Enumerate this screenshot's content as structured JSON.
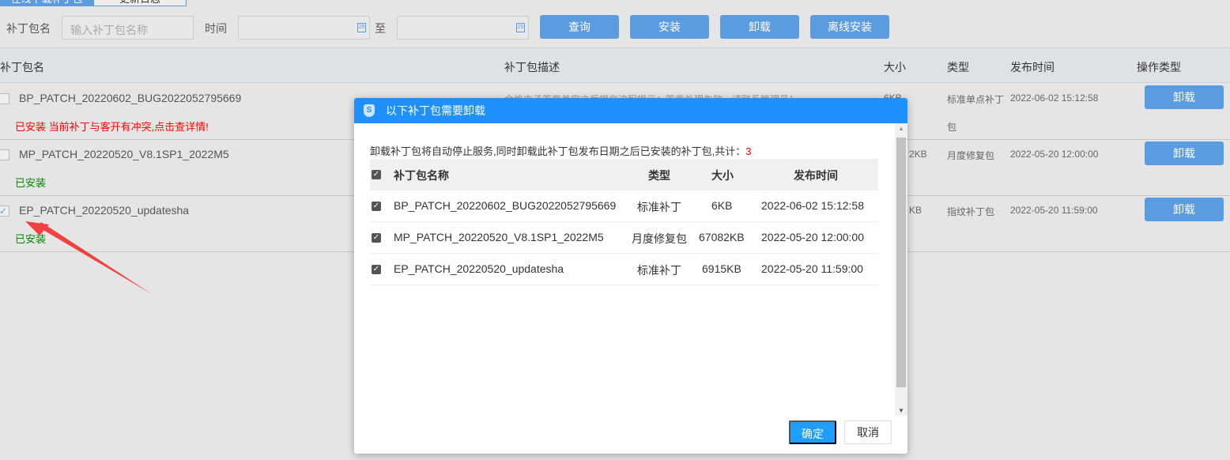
{
  "tabs": [
    "在线下载补丁包",
    "更新日志"
  ],
  "filter": {
    "name_label": "补丁包名",
    "name_placeholder": "输入补丁包名称",
    "time_label": "时间",
    "to_label": "至",
    "query": "查询",
    "install": "安装",
    "uninstall": "卸载",
    "offline_install": "离线安装"
  },
  "table": {
    "headers": [
      "补丁包名",
      "补丁包描述",
      "大小",
      "类型",
      "发布时间",
      "操作类型"
    ],
    "rows": [
      {
        "name": "BP_PATCH_20220602_BUG2022052795669",
        "status": "已安装 当前补丁与客开有冲突,点击查详情!",
        "desc": "金格电子签章盖完之后提交流程提示：签章处理失败，请联系管理员！",
        "size": "6KB",
        "type": "标准单点补丁",
        "type2": "包",
        "date": "2022-06-02 15:12:58",
        "action": "卸载",
        "checked": ""
      },
      {
        "name": "MP_PATCH_20220520_V8.1SP1_2022M5",
        "status": "已安装",
        "size": "2KB",
        "type": "月度修复包",
        "date": "2022-05-20 12:00:00",
        "action": "卸载",
        "checked": ""
      },
      {
        "name": "EP_PATCH_20220520_updatesha",
        "status": "已安装",
        "size": "KB",
        "type": "指纹补丁包",
        "date": "2022-05-20 11:59:00",
        "action": "卸载",
        "checked": "✓"
      }
    ]
  },
  "modal": {
    "title": "以下补丁包需要卸载",
    "message": "卸载补丁包将自动停止服务,同时卸载此补丁包发布日期之后已安装的补丁包,共计：",
    "count": "3",
    "headers": [
      "补丁包名称",
      "类型",
      "大小",
      "发布时间"
    ],
    "rows": [
      {
        "name": "BP_PATCH_20220602_BUG2022052795669",
        "type": "标准补丁",
        "size": "6KB",
        "date": "2022-06-02 15:12:58"
      },
      {
        "name": "MP_PATCH_20220520_V8.1SP1_2022M5",
        "type": "月度修复包",
        "size": "67082KB",
        "date": "2022-05-20 12:00:00"
      },
      {
        "name": "EP_PATCH_20220520_updatesha",
        "type": "标准补丁",
        "size": "6915KB",
        "date": "2022-05-20 11:59:00"
      }
    ],
    "ok": "确定",
    "cancel": "取消"
  },
  "colors": {
    "accent": "#1e90ff",
    "button": "#5b9be0",
    "error": "#ff0000",
    "success": "#008000",
    "arrow": "#f04040"
  }
}
